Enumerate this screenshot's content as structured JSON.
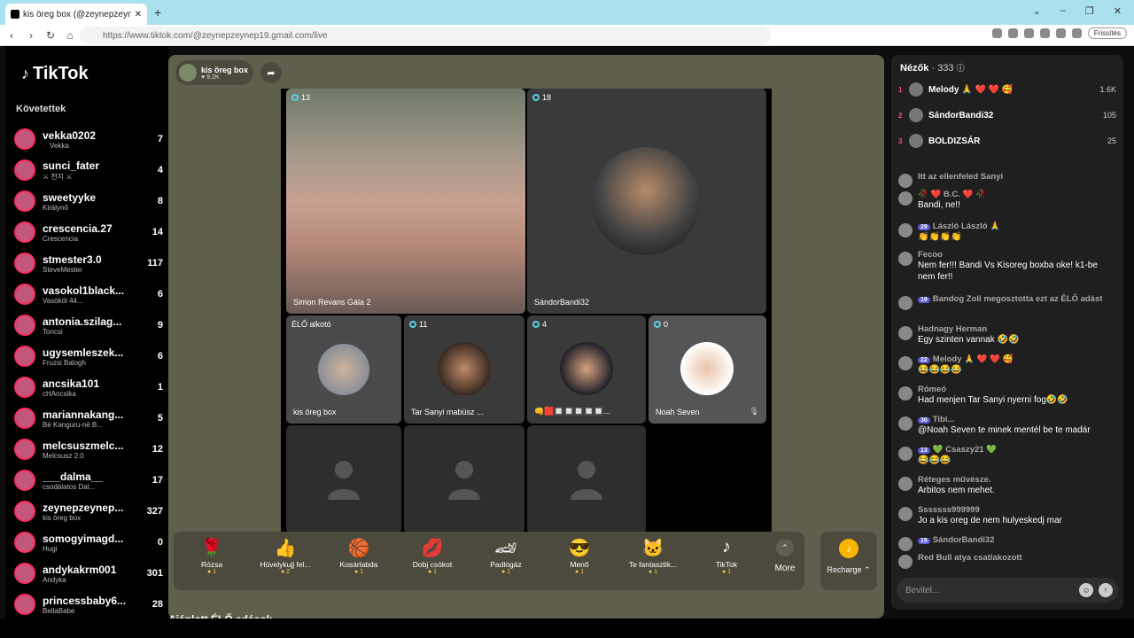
{
  "browser": {
    "tab_title": "kis öreg box (@zeynepzeyne…",
    "url": "https://www.tiktok.com/@zeynepzeynep19.gmail.com/live",
    "refresh_label": "Frissítés",
    "new_tab": "+",
    "win_min": "⌄",
    "win_max": "–",
    "win_restore": "❐",
    "win_close": "✕"
  },
  "sidebar": {
    "logo": "TikTok",
    "following_title": "Követettek",
    "accounts": [
      {
        "name": "vekka0202",
        "sub": " Vekka ",
        "count": "7"
      },
      {
        "name": "sunci_fater",
        "sub": "⚔ 천지 ⚔",
        "count": "4"
      },
      {
        "name": "sweetyyke",
        "sub": "Királynő",
        "count": "8"
      },
      {
        "name": "crescencia.27",
        "sub": "Crescencia",
        "count": "14"
      },
      {
        "name": "stmester3.0",
        "sub": "SteveMester",
        "count": "117"
      },
      {
        "name": "vasokol1black...",
        "sub": "Vasököl 44...",
        "count": "6"
      },
      {
        "name": "antonia.szilag...",
        "sub": "Toncsi",
        "count": "9"
      },
      {
        "name": "ugysemleszek...",
        "sub": "Fruzsi Balogh",
        "count": "6"
      },
      {
        "name": "ancsika101",
        "sub": "cHAncsika",
        "count": "1"
      },
      {
        "name": "mariannakang...",
        "sub": "Bé Kənguru-né B...",
        "count": "5"
      },
      {
        "name": "melcsuszmelc...",
        "sub": "Melcsusz 2.0",
        "count": "12"
      },
      {
        "name": "___dalma__",
        "sub": "csodálatos Dal...",
        "count": "17"
      },
      {
        "name": "zeynepzeynep...",
        "sub": "kis öreg box",
        "count": "327"
      },
      {
        "name": "somogyimagd...",
        "sub": "Hugi",
        "count": "0"
      },
      {
        "name": "andykakrm001",
        "sub": "Andyka",
        "count": "301"
      },
      {
        "name": "princessbaby6...",
        "sub": "BellaBabe",
        "count": "28"
      }
    ]
  },
  "live": {
    "host_name": "kis öreg box",
    "host_likes": "♥ 9.2K",
    "cells": [
      {
        "label": "Simon Revans Gála 2",
        "count": "13"
      },
      {
        "label": "SándorBandi32",
        "count": "18"
      },
      {
        "label": "kis öreg box",
        "count": "ÉLŐ alkotó"
      },
      {
        "label": "Tar Sanyi mabüsz ...",
        "count": "11"
      },
      {
        "label": "👊🟥🔲🔲🔲🔲🔲...",
        "count": "4"
      },
      {
        "label": "Noah Seven",
        "count": "0"
      }
    ],
    "recommended": "Ajánlott ÉLŐ adások"
  },
  "gifts": [
    {
      "name": "Rózsa",
      "price": "1",
      "icon": "🌹"
    },
    {
      "name": "Hüvelykujj fel...",
      "price": "2",
      "icon": "👍"
    },
    {
      "name": "Kosárlabda",
      "price": "1",
      "icon": "🏀"
    },
    {
      "name": "Dobj csókot",
      "price": "1",
      "icon": "💋"
    },
    {
      "name": "Padlógáz",
      "price": "1",
      "icon": "🏎"
    },
    {
      "name": "Menő",
      "price": "1",
      "icon": "😎"
    },
    {
      "name": "Te fantasztik...",
      "price": "1",
      "icon": "🐱"
    },
    {
      "name": "TikTok",
      "price": "1",
      "icon": "♪"
    }
  ],
  "gift_more": "More",
  "recharge": "Recharge ⌃",
  "chat": {
    "viewers_title": "Nézők",
    "viewers_count": "· 333",
    "top": [
      {
        "rank": "1",
        "name": "Melody 🙏 ❤️ ❤️ 🥰",
        "score": "1.6K"
      },
      {
        "rank": "2",
        "name": "SándorBandi32",
        "score": "105"
      },
      {
        "rank": "3",
        "name": "BOLDIZSÁR",
        "score": "25"
      }
    ],
    "messages": [
      {
        "user": "Itt az ellenfeled Sanyi",
        "text": "",
        "lvl": ""
      },
      {
        "user": "🥀 ❤️ B.C. ❤️ 🥀",
        "text": "Bandi, ne!!",
        "lvl": ""
      },
      {
        "user": "László László 🙏",
        "text": "👏👏👏👏",
        "lvl": "29"
      },
      {
        "user": "Fecoo",
        "text": "Nem fer!!! Bandi Vs Kisoreg boxba oke! k1-be nem fer!!",
        "lvl": ""
      },
      {
        "user": "Bandog Zoli megosztotta ezt az ÉLŐ adást",
        "text": "",
        "lvl": "19"
      },
      {
        "user": "Hadnagy Herman",
        "text": "Egy szinten vannak 🤣🤣",
        "lvl": ""
      },
      {
        "user": "Melody 🙏 ❤️ ❤️ 🥰",
        "text": "😂😂😂😂",
        "lvl": "22"
      },
      {
        "user": "Rómeó",
        "text": "Had menjen Tar Sanyi nyerni fog🤣🤣",
        "lvl": ""
      },
      {
        "user": "Tibi...",
        "text": "@Noah Seven te minek mentél be te madár",
        "lvl": "30"
      },
      {
        "user": "💚 Csaszy21 💚",
        "text": "😂😂😂",
        "lvl": "13"
      },
      {
        "user": "Réteges művésze.",
        "text": "Arbitos nem mehet.",
        "lvl": ""
      },
      {
        "user": "Sssssss999999",
        "text": "Jo a kis oreg de nem hulyeskedj mar",
        "lvl": ""
      },
      {
        "user": "SándorBandi32",
        "text": "",
        "lvl": "15"
      },
      {
        "user": "Red Bull atya csatlakozott",
        "text": "",
        "lvl": ""
      }
    ],
    "input_placeholder": "Bevitel..."
  }
}
